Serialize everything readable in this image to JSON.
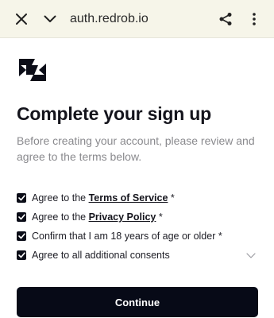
{
  "browser": {
    "url": "auth.redrob.io",
    "icons": {
      "close": "close-icon",
      "collapse": "chevron-down-icon",
      "share": "share-icon",
      "more": "more-vert-icon"
    }
  },
  "brand": {
    "logo": "redrob-logo",
    "color": "#0b0d18"
  },
  "page": {
    "title": "Complete your sign up",
    "subtitle": "Before creating your account, please review and agree to the terms below."
  },
  "consents": [
    {
      "prefix": "Agree to the ",
      "link": "Terms of Service",
      "suffix": " *",
      "checked": true
    },
    {
      "prefix": "Agree to the ",
      "link": "Privacy Policy",
      "suffix": " *",
      "checked": true
    },
    {
      "prefix": "Confirm that I am 18 years of age or older *",
      "link": "",
      "suffix": "",
      "checked": true
    },
    {
      "prefix": "Agree to all additional consents",
      "link": "",
      "suffix": "",
      "checked": true,
      "expandable": true
    }
  ],
  "actions": {
    "continue_label": "Continue"
  },
  "colors": {
    "topbar": "#f6f5e9",
    "button": "#070a17",
    "subtitle": "#8a8a8e"
  }
}
